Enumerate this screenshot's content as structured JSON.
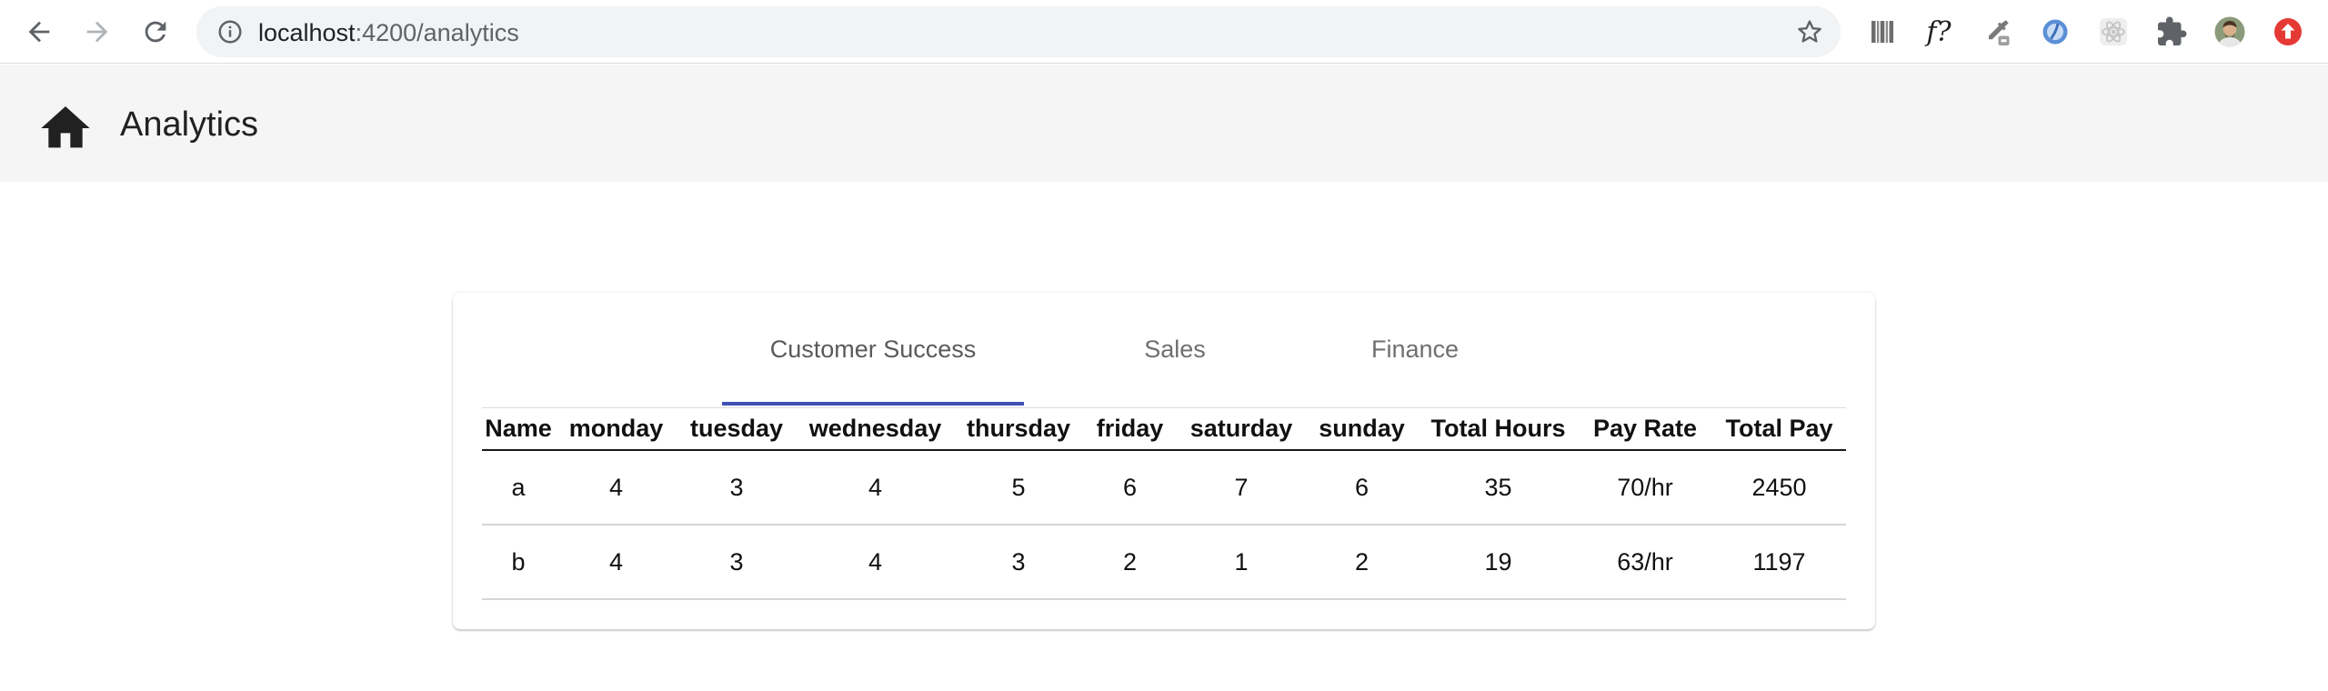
{
  "browser": {
    "url_host": "localhost",
    "url_path": ":4200/analytics",
    "extensions": [
      "barcode-icon",
      "f-question-icon",
      "eyedropper-icon",
      "blue-orb-icon",
      "react-icon",
      "puzzle-icon",
      "profile-avatar",
      "update-icon"
    ],
    "extension_f_label": "f?"
  },
  "app": {
    "title": "Analytics"
  },
  "tabs": [
    {
      "label": "Customer Success",
      "active": true
    },
    {
      "label": "Sales",
      "active": false
    },
    {
      "label": "Finance",
      "active": false
    }
  ],
  "table": {
    "headers": [
      "Name",
      "monday",
      "tuesday",
      "wednesday",
      "thursday",
      "friday",
      "saturday",
      "sunday",
      "Total Hours",
      "Pay Rate",
      "Total Pay"
    ],
    "rows": [
      [
        "a",
        "4",
        "3",
        "4",
        "5",
        "6",
        "7",
        "6",
        "35",
        "70/hr",
        "2450"
      ],
      [
        "b",
        "4",
        "3",
        "4",
        "3",
        "2",
        "1",
        "2",
        "19",
        "63/hr",
        "1197"
      ]
    ]
  },
  "colors": {
    "tab_ink": "#3f51b5",
    "toolbar_bg": "#f5f5f5",
    "update_badge": "#e53935"
  }
}
